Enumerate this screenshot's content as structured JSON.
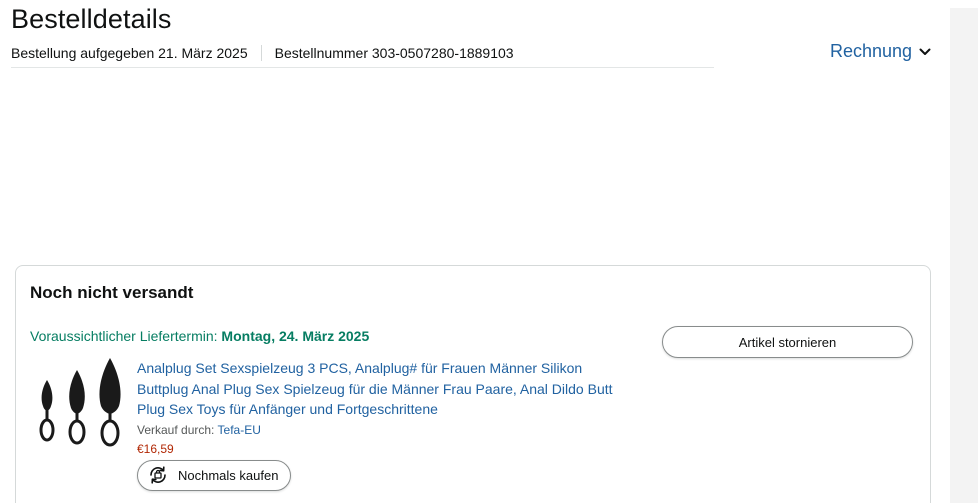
{
  "header": {
    "title": "Bestelldetails",
    "order_placed": "Bestellung aufgegeben 21. März 2025",
    "order_number": "Bestellnummer 303-0507280-1889103",
    "invoice_label": "Rechnung"
  },
  "shipment": {
    "status": "Noch nicht versandt",
    "delivery_label": "Voraussichtlicher Liefertermin:",
    "delivery_date": "Montag, 24. März 2025",
    "cancel_label": "Artikel stornieren",
    "item": {
      "title": "Analplug Set Sexspielzeug 3 PCS, Analplug# für Frauen Männer Silikon Buttplug Anal Plug Sex Spielzeug für die Männer Frau Paare, Anal Dildo Butt Plug Sex Toys für Anfänger und Fortgeschrittene",
      "seller_label": "Verkauf durch:",
      "seller_name": "Tefa-EU",
      "price": "€16,59",
      "rebuy_label": "Nochmals kaufen"
    }
  },
  "icons": {
    "invoice_chevron": "chevron-down-icon",
    "rebuy": "rebuy-icon"
  },
  "colors": {
    "link": "#2162a1",
    "delivery_green": "#067d62",
    "price_red": "#b12704",
    "text": "#0f1111",
    "border": "#d5d9d9"
  }
}
